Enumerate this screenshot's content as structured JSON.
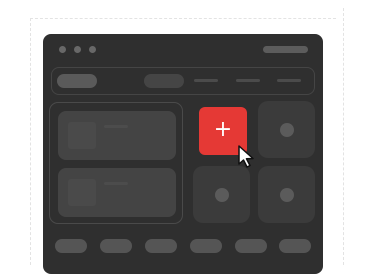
{
  "canvas": {
    "background": "#ffffff",
    "guide_color": "#e3e3e3"
  },
  "window": {
    "background": "#2f2f2f",
    "window_controls": [
      "dot",
      "dot",
      "dot"
    ],
    "title_placeholder": true
  },
  "toolbar": {
    "has_primary_pill": true,
    "has_secondary_pill": true,
    "menu_lines": 3
  },
  "left_panel": {
    "cards": [
      {
        "has_thumbnail": true,
        "has_text_line": true
      },
      {
        "has_thumbnail": true,
        "has_text_line": true
      }
    ]
  },
  "grid": {
    "add_button": {
      "label": "+",
      "icon": "plus-icon",
      "color": "#e53935",
      "hovered": true
    },
    "tiles": [
      {
        "icon": "dot-icon"
      },
      {
        "icon": "dot-icon"
      },
      {
        "icon": "dot-icon"
      }
    ]
  },
  "cursor": {
    "icon": "arrow-cursor-icon"
  },
  "bottom_bar": {
    "chips": 6
  }
}
